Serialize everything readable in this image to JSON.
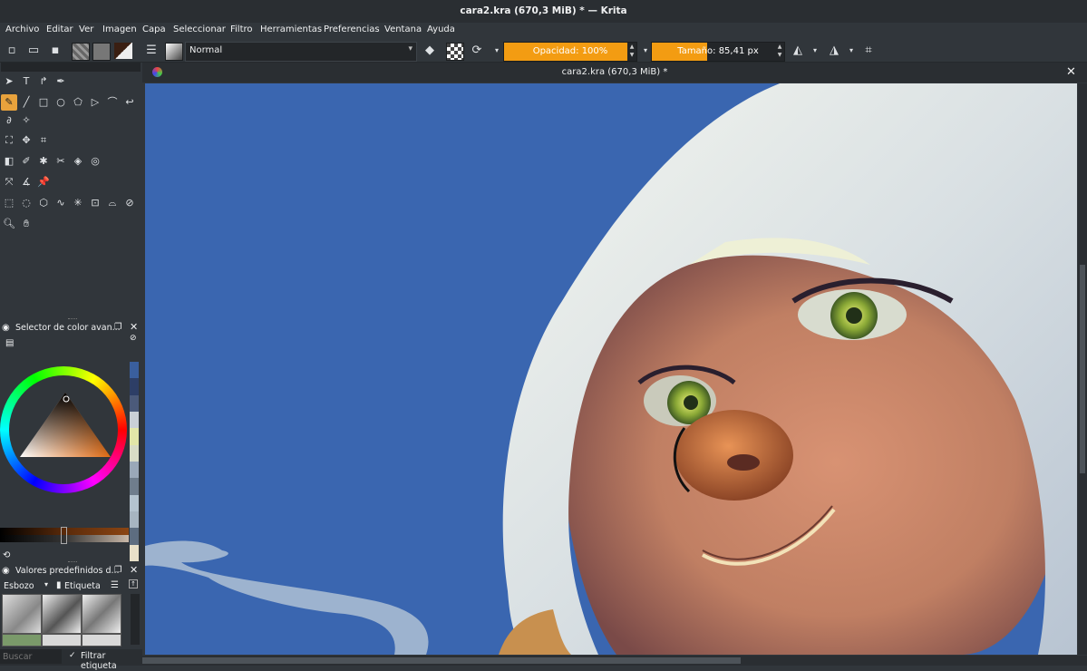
{
  "window": {
    "title": "cara2.kra (670,3 MiB) * — Krita"
  },
  "menu": [
    "Archivo",
    "Editar",
    "Ver",
    "Imagen",
    "Capa",
    "Seleccionar",
    "Filtro",
    "Herramientas",
    "Preferencias",
    "Ventana",
    "Ayuda"
  ],
  "toolbar": {
    "blend_mode": "Normal",
    "opacity_label": "Opacidad: 100%",
    "opacity_value": 1.0,
    "size_label": "Tamaño: 85,41 px"
  },
  "document": {
    "tab_title": "cara2.kra (670,3 MiB) *"
  },
  "color_docker": {
    "title": "Selector de color avan..."
  },
  "presets_docker": {
    "title": "Valores predefinidos d...",
    "category": "Esbozo",
    "tag_label": "Etiqueta",
    "search_placeholder": "Buscar",
    "filter_label": "Filtrar etiqueta"
  },
  "colors": {
    "accent": "#f39c12",
    "active_tool": "#e8a23c",
    "sky": "#3a66b0",
    "background": "#31363b"
  },
  "palette_swatches": [
    "#3a5f9e",
    "#2d3e66",
    "#4b5a7a",
    "#c9cfd6",
    "#e2e6a8",
    "#d8dcc6",
    "#9aa8b8",
    "#6f7d8c",
    "#b4c3cf",
    "#a7b5c1",
    "#5d6d80",
    "#e8e0c8"
  ]
}
